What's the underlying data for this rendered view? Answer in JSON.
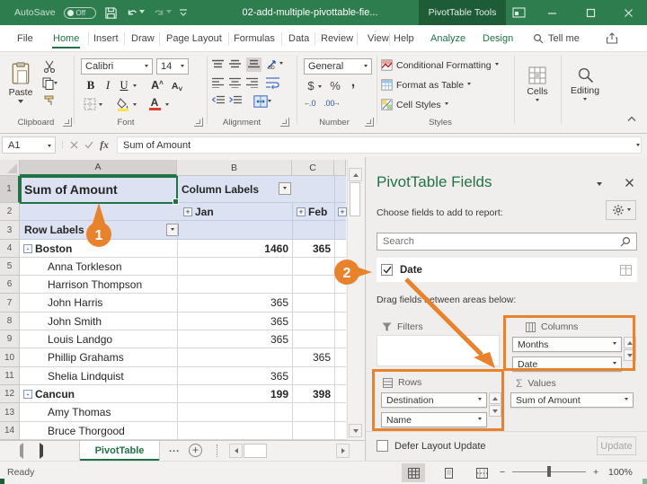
{
  "titlebar": {
    "autosave_label": "AutoSave",
    "autosave_state": "Off",
    "document_title": "02-add-multiple-pivottable-fie...",
    "contextual_tab": "PivotTable Tools"
  },
  "ribbon": {
    "tabs": [
      {
        "label": "File"
      },
      {
        "label": "Home"
      },
      {
        "label": "Insert"
      },
      {
        "label": "Draw"
      },
      {
        "label": "Page Layout"
      },
      {
        "label": "Formulas"
      },
      {
        "label": "Data"
      },
      {
        "label": "Review"
      },
      {
        "label": "View"
      },
      {
        "label": "Help"
      },
      {
        "label": "Analyze"
      },
      {
        "label": "Design"
      }
    ],
    "tell_me": "Tell me",
    "clipboard": {
      "label": "Clipboard",
      "paste": "Paste"
    },
    "font": {
      "label": "Font",
      "font_name": "Calibri",
      "font_size": "14",
      "bold": "B",
      "italic": "I",
      "underline": "U"
    },
    "alignment": {
      "label": "Alignment"
    },
    "number": {
      "label": "Number",
      "format": "General",
      "currency": "$",
      "percent": "%",
      "comma": ","
    },
    "styles": {
      "label": "Styles",
      "conditional": "Conditional Formatting",
      "format_table": "Format as Table",
      "cell_styles": "Cell Styles"
    },
    "cells": {
      "label": "Cells"
    },
    "editing": {
      "label": "Editing"
    }
  },
  "formula_bar": {
    "name_box": "A1",
    "fx": "fx",
    "formula": "Sum of Amount"
  },
  "grid": {
    "col_headers": [
      "A",
      "B",
      "C"
    ],
    "a1": "Sum of Amount",
    "b1": "Column Labels",
    "jan": "Jan",
    "feb": "Feb",
    "a3": "Row Labels",
    "rows": [
      {
        "num": "4",
        "label": "Boston",
        "b": "1460",
        "c": "365"
      },
      {
        "num": "5",
        "label": "Anna Torkleson",
        "b": "",
        "c": ""
      },
      {
        "num": "6",
        "label": "Harrison Thompson",
        "b": "",
        "c": ""
      },
      {
        "num": "7",
        "label": "John Harris",
        "b": "365",
        "c": ""
      },
      {
        "num": "8",
        "label": "John Smith",
        "b": "365",
        "c": ""
      },
      {
        "num": "9",
        "label": "Louis Landgo",
        "b": "365",
        "c": ""
      },
      {
        "num": "10",
        "label": "Phillip Grahams",
        "b": "",
        "c": "365"
      },
      {
        "num": "11",
        "label": "Shelia Lindquist",
        "b": "365",
        "c": ""
      },
      {
        "num": "12",
        "label": "Cancun",
        "b": "199",
        "c": "398"
      },
      {
        "num": "13",
        "label": "Amy Thomas",
        "b": "",
        "c": ""
      },
      {
        "num": "14",
        "label": "Bruce Thorgood",
        "b": "",
        "c": ""
      }
    ],
    "row_numbers_header": [
      "1",
      "2",
      "3"
    ]
  },
  "sheet_tabs": {
    "active": "PivotTable",
    "overflow": "..."
  },
  "status_bar": {
    "status": "Ready",
    "zoom": "100%"
  },
  "pane": {
    "title": "PivotTable Fields",
    "choose_label": "Choose fields to add to report:",
    "search_placeholder": "Search",
    "field_date": "Date",
    "drag_label": "Drag fields between areas below:",
    "filters_label": "Filters",
    "columns_label": "Columns",
    "rows_label": "Rows",
    "values_label": "Values",
    "columns_items": [
      {
        "label": "Months"
      },
      {
        "label": "Date"
      }
    ],
    "rows_items": [
      {
        "label": "Destination"
      },
      {
        "label": "Name"
      }
    ],
    "values_items": [
      {
        "label": "Sum of Amount"
      }
    ],
    "defer_label": "Defer Layout Update",
    "update_button": "Update",
    "sigma": "Σ"
  },
  "annotations": {
    "step1": "1",
    "step2": "2"
  },
  "colors": {
    "excel_green": "#217346",
    "title_green": "#2E7D4F",
    "accent_orange": "#E8822D",
    "pivot_header_blue": "#DCE2F1"
  }
}
